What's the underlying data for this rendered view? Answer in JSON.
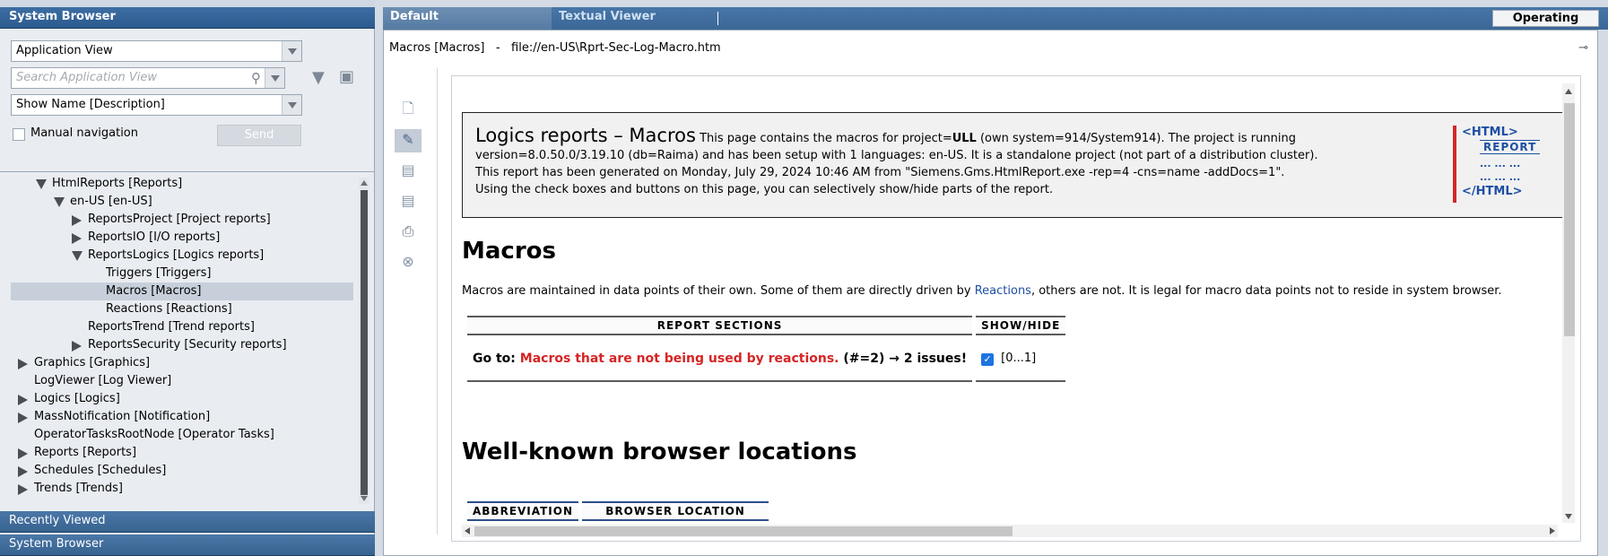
{
  "left_panel": {
    "header": "System Browser",
    "view_select": "Application View",
    "search_placeholder": "Search Application View",
    "display_select": "Show Name [Description]",
    "manual_nav_label": "Manual navigation",
    "send_label": "Send",
    "tree": [
      {
        "label": "HtmlReports [Reports]",
        "level": 2,
        "expander": "expanded"
      },
      {
        "label": "en-US [en-US]",
        "level": 3,
        "expander": "expanded"
      },
      {
        "label": "ReportsProject [Project reports]",
        "level": 4,
        "expander": "collapsed"
      },
      {
        "label": "ReportsIO [I/O reports]",
        "level": 4,
        "expander": "collapsed"
      },
      {
        "label": "ReportsLogics [Logics reports]",
        "level": 4,
        "expander": "expanded"
      },
      {
        "label": "Triggers [Triggers]",
        "level": 5,
        "expander": "none"
      },
      {
        "label": "Macros [Macros]",
        "level": 5,
        "expander": "none",
        "selected": true
      },
      {
        "label": "Reactions [Reactions]",
        "level": 5,
        "expander": "none"
      },
      {
        "label": "ReportsTrend [Trend reports]",
        "level": 4,
        "expander": "none"
      },
      {
        "label": "ReportsSecurity [Security reports]",
        "level": 4,
        "expander": "collapsed"
      },
      {
        "label": "Graphics [Graphics]",
        "level": 1,
        "expander": "collapsed"
      },
      {
        "label": "LogViewer [Log Viewer]",
        "level": 1,
        "expander": "none"
      },
      {
        "label": "Logics [Logics]",
        "level": 1,
        "expander": "collapsed"
      },
      {
        "label": "MassNotification [Notification]",
        "level": 1,
        "expander": "collapsed"
      },
      {
        "label": "OperatorTasksRootNode [Operator Tasks]",
        "level": 1,
        "expander": "none"
      },
      {
        "label": "Reports [Reports]",
        "level": 1,
        "expander": "collapsed"
      },
      {
        "label": "Schedules [Schedules]",
        "level": 1,
        "expander": "collapsed"
      },
      {
        "label": "Trends [Trends]",
        "level": 1,
        "expander": "collapsed"
      }
    ],
    "recently_viewed": "Recently Viewed",
    "system_browser_footer": "System Browser"
  },
  "right_panel": {
    "tabs": [
      "Default",
      "Textual Viewer"
    ],
    "status": "Operating",
    "path_name": "Macros [Macros]",
    "path_sep": "-",
    "path_url": "file://en-US\\Rprt-Sec-Log-Macro.htm",
    "tool_icons": [
      "new-doc-icon",
      "edit-icon",
      "save-icon",
      "save-as-icon",
      "print-icon",
      "close-icon"
    ]
  },
  "report": {
    "title": "Logics reports – Macros",
    "intro_1": " This page contains the macros for project=",
    "project": "ULL",
    "intro_2": " (own system=914/System914). The project is running version=8.0.50.0/3.19.10 (db=Raima) and has been setup with 1 languages: en-US. It is a standalone project (not part of a distribution cluster).",
    "line_2": "This report has been generated on Monday, July 29, 2024 10:46 AM from \"Siemens.Gms.HtmlReport.exe -rep=4 -cns=name -addDocs=1\".",
    "line_3": "Using the check boxes and buttons on this page, you can selectively show/hide parts of the report.",
    "logo": {
      "open": "<HTML>",
      "word": "REPORT",
      "dots": "... ... ...",
      "close": "</HTML>"
    },
    "macros_heading": "Macros",
    "macros_text_1": "Macros are maintained in data points of their own. Some of them are directly driven by ",
    "macros_link": "Reactions",
    "macros_text_2": ", others are not. It is legal for macro data points not to reside in system browser.",
    "sections_headers": [
      "REPORT SECTIONS",
      "SHOW/HIDE"
    ],
    "goto_prefix": "Go to: ",
    "goto_link": "Macros that are not being used by reactions.",
    "goto_suffix": " (#=2) → 2 issues!",
    "show_range": "[0...1]",
    "wk_heading": "Well-known browser locations",
    "wk_headers": [
      "ABBREVIATION",
      "BROWSER LOCATION"
    ]
  }
}
